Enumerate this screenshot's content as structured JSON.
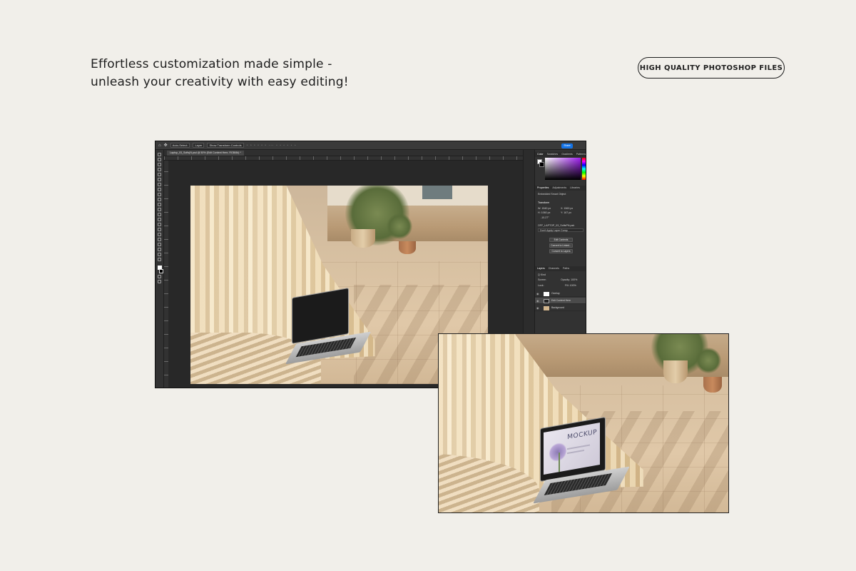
{
  "headline": {
    "line1": "Effortless customization made simple -",
    "line2": "unleash your creativity with easy editing!"
  },
  "badge": {
    "label": "HIGH QUALITY PHOTOSHOP FILES"
  },
  "photoshop": {
    "options_bar": {
      "auto_select": "Auto-Select:",
      "layer_select": "Layer",
      "show_transform": "Show Transform Controls",
      "share": "Share"
    },
    "document_tab": "Laptop_03_Softs(N.psd @ 50% (Edit Content Here, RGB/8#) *",
    "panels": {
      "color_tabs": [
        "Color",
        "Swatches",
        "Gradients",
        "Patterns"
      ],
      "properties_tabs": [
        "Properties",
        "Adjustments",
        "Libraries"
      ],
      "properties_type": "Embedded Smart Object",
      "transform_label": "Transform",
      "w_value": "W: 1540 px",
      "x_value": "X: 1563 px",
      "h_value": "H: 1060 px",
      "y_value": "Y: 167 px",
      "angle_value": "-10.27°",
      "linked_file": "OFF_LAPTOP_03_SoftsPN.psb",
      "layer_comp": "Don't Apply Layer Comp",
      "buttons": [
        "Edit Contents",
        "Convert to Linked...",
        "Convert to Layers"
      ],
      "layers_tabs": [
        "Layers",
        "Channels",
        "Paths"
      ],
      "kind_label": "Q Kind",
      "blend_mode": "Screen",
      "opacity": "Opacity: 100%",
      "lock_label": "Lock:",
      "fill": "Fill: 100%",
      "layers": [
        "Overlay",
        "Edit Content Here",
        "Background"
      ]
    }
  },
  "preview": {
    "mockup_word": "MOCKUP"
  }
}
